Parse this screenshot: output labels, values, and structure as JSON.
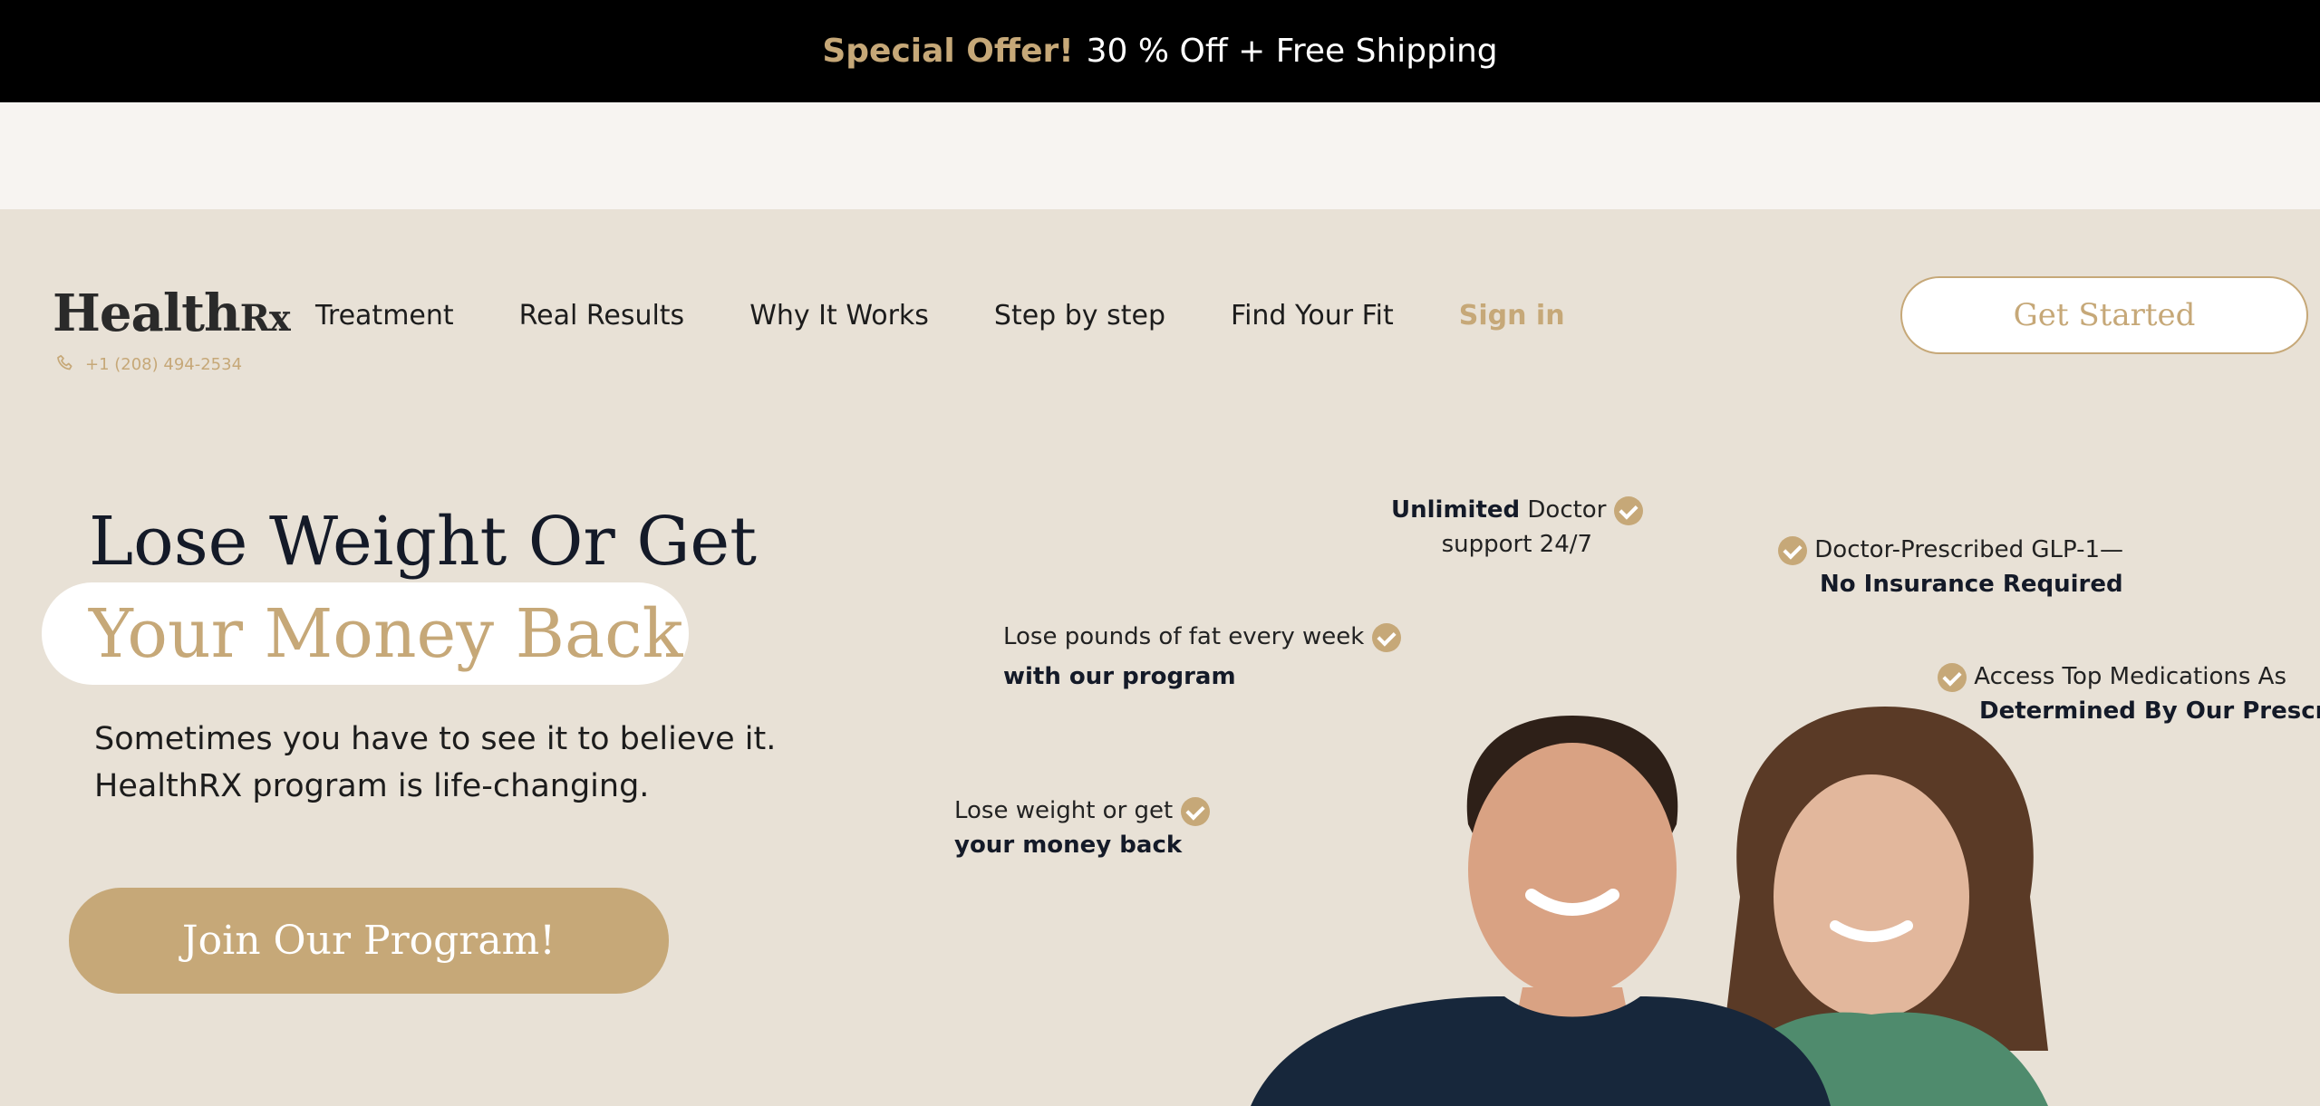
{
  "promo": {
    "highlight": "Special Offer!",
    "text": "30 % Off + Free Shipping"
  },
  "header": {
    "logo": {
      "main": "Health",
      "suffix": "Rx"
    },
    "phone": "+1 (208) 494-2534",
    "menu": [
      {
        "label": "Treatment"
      },
      {
        "label": "Real Results"
      },
      {
        "label": "Why It Works"
      },
      {
        "label": "Step by step"
      },
      {
        "label": "Find Your Fit"
      },
      {
        "label": "Sign in"
      }
    ],
    "cta": "Get Started"
  },
  "hero": {
    "title_line1": "Lose Weight Or Get",
    "title_line2": "Your Money Back",
    "subtitle_line1": "Sometimes you have to see it to believe it.",
    "subtitle_line2": "HealthRX program is life-changing.",
    "cta": "Join Our Program!"
  },
  "badges": [
    {
      "bold": "Unlimited",
      "text": " Doctor",
      "line2": "support 24/7"
    },
    {
      "text": "Doctor-Prescribed GLP-1—",
      "bold2": "No Insurance Required"
    },
    {
      "text": "Lose pounds of fat every week",
      "bold2": "with our program"
    },
    {
      "text": "Access Top Medications As",
      "bold2": "Determined By Our Prescribe"
    },
    {
      "text": "Lose weight or get",
      "bold2": "your money back"
    }
  ],
  "colors": {
    "accent": "#c6a878",
    "background": "#e8e1d6",
    "promo_bg": "#000000",
    "strip": "#f7f4f1",
    "navy": "#141a28"
  }
}
